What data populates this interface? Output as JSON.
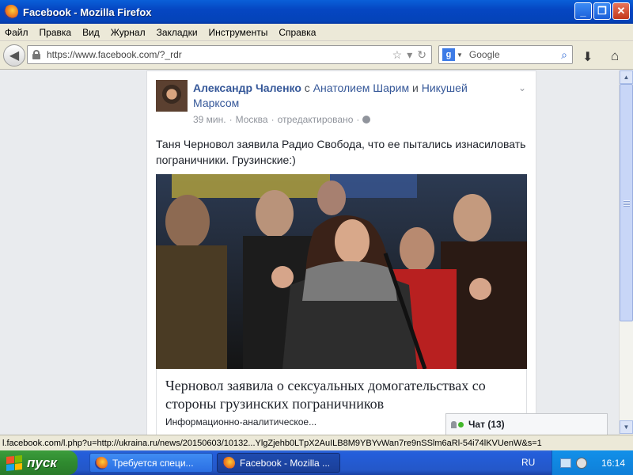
{
  "window": {
    "title": "Facebook - Mozilla Firefox",
    "buttons": {
      "minimize": "_",
      "maximize": "❐",
      "close": "✕"
    }
  },
  "menu": [
    "Файл",
    "Правка",
    "Вид",
    "Журнал",
    "Закладки",
    "Инструменты",
    "Справка"
  ],
  "nav": {
    "url": "https://www.facebook.com/?_rdr",
    "search_placeholder": "Google"
  },
  "post": {
    "author": "Александр Чаленко",
    "with_word": "с",
    "tag1": "Анатолием Шарим",
    "and_word": "и",
    "tag2": "Никушей Марксом",
    "time": "39 мин.",
    "sep": "·",
    "location": "Москва",
    "edited": "отредактировано",
    "text": "Таня Черновол заявила Радио Свобода, что ее пытались изнасиловать пограничники. Грузинские:)",
    "link_title": "Черновол заявила о сексуальных домогательствах со стороны грузинских пограничников",
    "link_desc": "Информационно-аналитическое..."
  },
  "chat": {
    "label": "Чат (13)"
  },
  "status": {
    "text": "l.facebook.com/l.php?u=http://ukraina.ru/news/20150603/10132...YlgZjehb0LTpX2AuILB8M9YBYvWan7re9nSSlm6aRl-54i74lKVUenW&s=1"
  },
  "taskbar": {
    "start": "пуск",
    "tasks": [
      "Требуется специ...",
      "Facebook - Mozilla ..."
    ],
    "lang": "RU",
    "clock": "16:14"
  }
}
